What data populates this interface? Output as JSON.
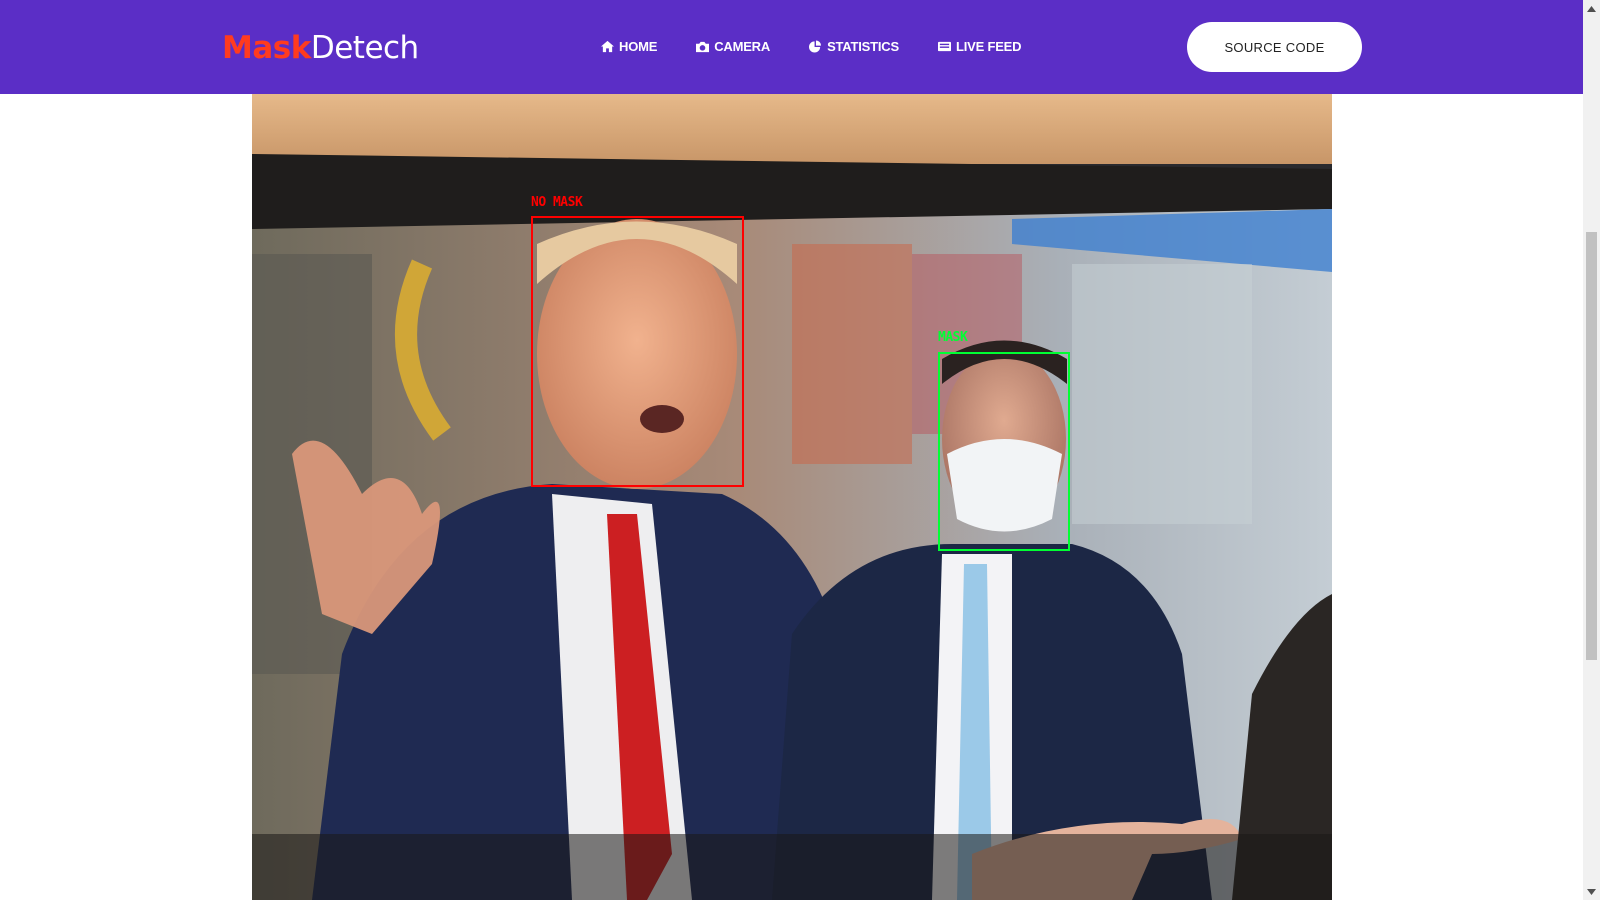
{
  "brand": {
    "part1": "Mask",
    "part2": "Detech"
  },
  "nav": {
    "items": [
      {
        "label": "HOME",
        "icon": "home-icon"
      },
      {
        "label": "CAMERA",
        "icon": "camera-icon"
      },
      {
        "label": "STATISTICS",
        "icon": "pie-chart-icon"
      },
      {
        "label": "LIVE FEED",
        "icon": "feed-icon"
      }
    ],
    "source_button": "SOURCE CODE"
  },
  "feed": {
    "detections": [
      {
        "label": "NO MASK",
        "status": "no-mask",
        "color": "#ff0000"
      },
      {
        "label": "MASK",
        "status": "mask",
        "color": "#00ff33"
      }
    ]
  },
  "colors": {
    "navbar": "#5b2ec6",
    "brand_accent": "#ff3b1f",
    "no_mask": "#ff0000",
    "mask": "#00ff33"
  }
}
